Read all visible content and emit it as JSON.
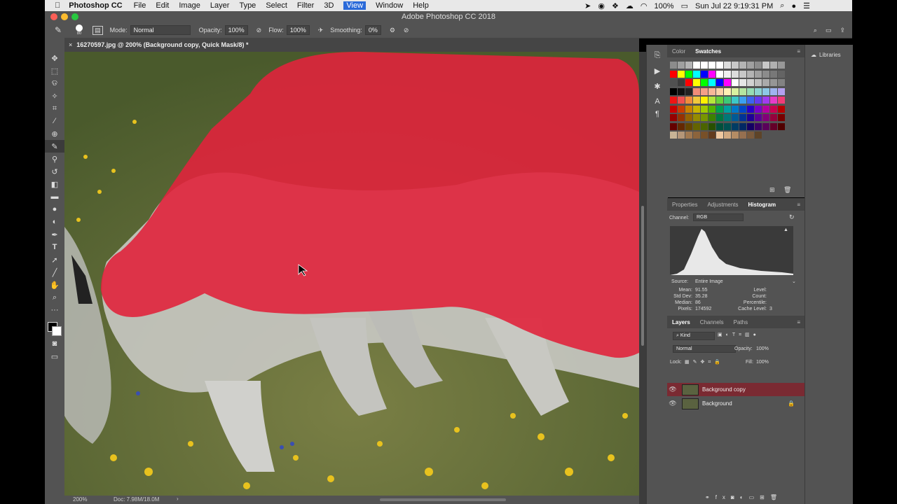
{
  "menubar": {
    "app": "Photoshop CC",
    "items": [
      "File",
      "Edit",
      "Image",
      "Layer",
      "Type",
      "Select",
      "Filter",
      "3D",
      "View",
      "Window",
      "Help"
    ],
    "active": "View",
    "battery": "100%",
    "clock": "Sun Jul 22  9:19:31 PM"
  },
  "window": {
    "title": "Adobe Photoshop CC 2018"
  },
  "options": {
    "brush_size": "80",
    "mode_label": "Mode:",
    "mode_value": "Normal",
    "opacity_label": "Opacity:",
    "opacity_value": "100%",
    "flow_label": "Flow:",
    "flow_value": "100%",
    "smoothing_label": "Smoothing:",
    "smoothing_value": "0%"
  },
  "document": {
    "tab_title": "16270597.jpg @ 200% (Background copy, Quick Mask/8) *",
    "zoom": "200%",
    "doc_info": "Doc: 7.98M/18.0M"
  },
  "swatches": {
    "tabs": [
      "Color",
      "Swatches"
    ],
    "active": "Swatches"
  },
  "histogram": {
    "tabs": [
      "Properties",
      "Adjustments",
      "Histogram"
    ],
    "active": "Histogram",
    "channel_label": "Channel:",
    "channel_value": "RGB",
    "source_label": "Source:",
    "source_value": "Entire Image",
    "stats_left": [
      {
        "k": "Mean:",
        "v": "91.55"
      },
      {
        "k": "Std Dev:",
        "v": "35.28"
      },
      {
        "k": "Median:",
        "v": "86"
      },
      {
        "k": "Pixels:",
        "v": "174592"
      }
    ],
    "stats_right": [
      {
        "k": "Level:",
        "v": ""
      },
      {
        "k": "Count:",
        "v": ""
      },
      {
        "k": "Percentile:",
        "v": ""
      },
      {
        "k": "Cache Level:",
        "v": "3"
      }
    ]
  },
  "layers": {
    "tabs": [
      "Layers",
      "Channels",
      "Paths"
    ],
    "active": "Layers",
    "filter": "Kind",
    "blend": "Normal",
    "opacity_label": "Opacity:",
    "opacity_value": "100%",
    "lock_label": "Lock:",
    "fill_label": "Fill:",
    "fill_value": "100%",
    "items": [
      {
        "name": "Background copy",
        "selected": true,
        "locked": false
      },
      {
        "name": "Background",
        "selected": false,
        "locked": true
      }
    ]
  },
  "libraries": {
    "label": "Libraries"
  },
  "colors": {
    "mask": "#e0243c",
    "selected_layer": "#7a2a32",
    "accent": "#2a6ad9"
  }
}
